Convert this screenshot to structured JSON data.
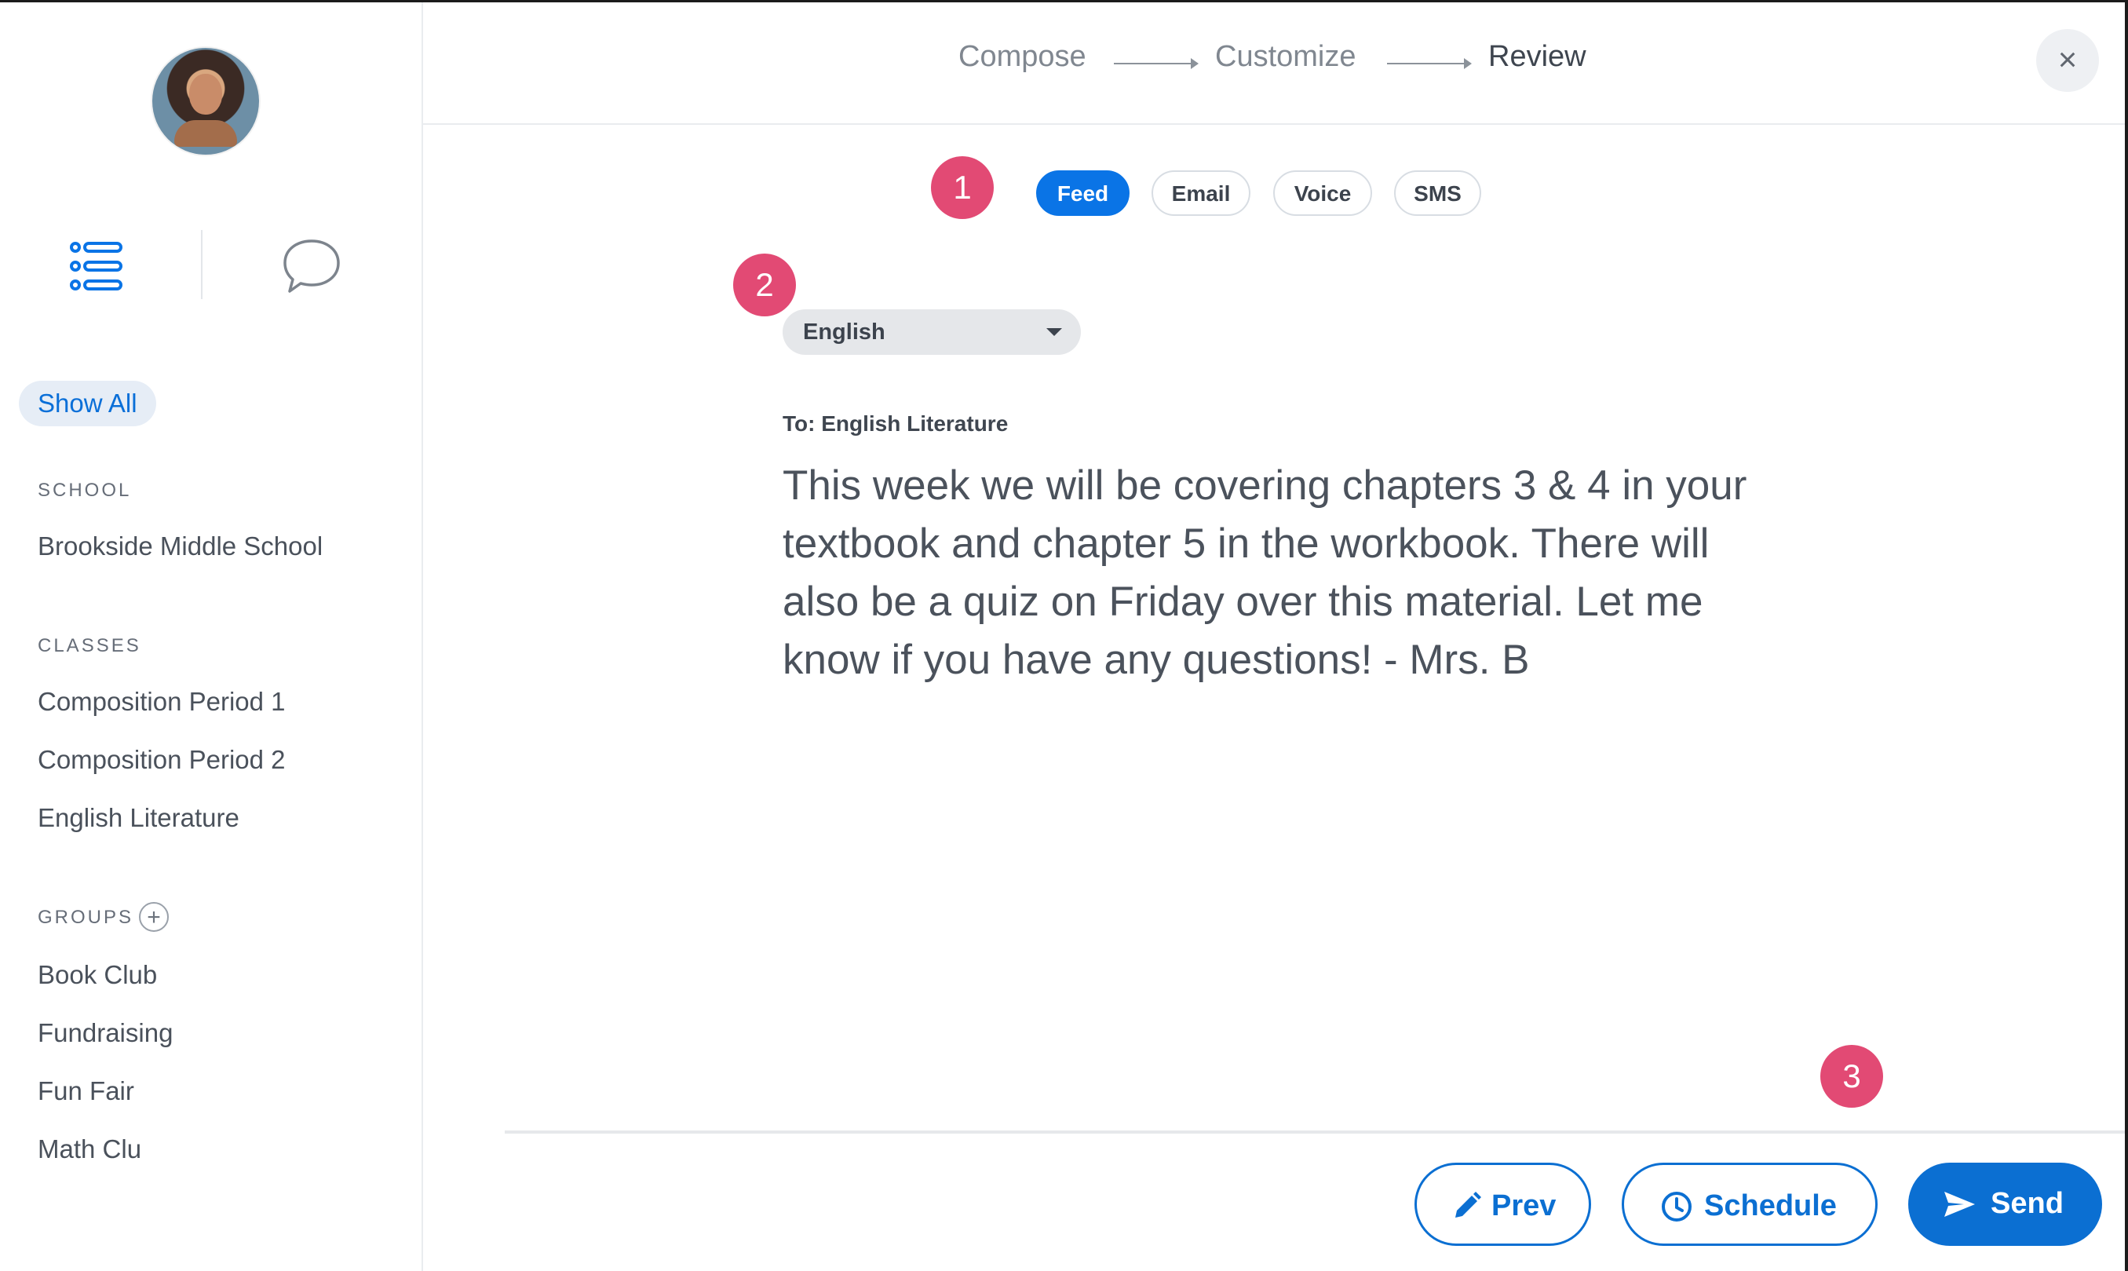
{
  "sidebar": {
    "view_switch": [
      "list-view-icon",
      "chat-view-icon"
    ],
    "show_all_label": "Show All",
    "school": {
      "label": "SCHOOL",
      "items": [
        "Brookside Middle School"
      ]
    },
    "classes": {
      "label": "CLASSES",
      "items": [
        "Composition Period 1",
        "Composition Period 2",
        "English Literature"
      ]
    },
    "groups": {
      "label": "GROUPS",
      "add_icon": "+",
      "items": [
        "Book Club",
        "Fundraising",
        "Fun Fair",
        "Math Clu"
      ]
    }
  },
  "stepper": {
    "steps": [
      {
        "label": "Compose",
        "state": "done"
      },
      {
        "label": "Customize",
        "state": "done"
      },
      {
        "label": "Review",
        "state": "active"
      }
    ],
    "close_icon": "×"
  },
  "main": {
    "channels": [
      {
        "label": "Feed",
        "active": true
      },
      {
        "label": "Email",
        "active": false
      },
      {
        "label": "Voice",
        "active": false
      },
      {
        "label": "SMS",
        "active": false
      }
    ],
    "language": "English",
    "to_label": "To: English Literature",
    "message": "This week we will be covering chapters 3 & 4 in your textbook and chapter 5 in the workbook. There will also be a quiz on Friday over this material. Let me know if you have any questions! - Mrs. B",
    "badges": [
      "1",
      "2",
      "3"
    ]
  },
  "actions": {
    "prev": {
      "label": "Prev",
      "icon": "pencil-icon"
    },
    "schedule": {
      "label": "Schedule",
      "icon": "clock-icon"
    },
    "send": {
      "label": "Send",
      "icon": "send-icon"
    }
  },
  "colors": {
    "accent": "#0b6fd2",
    "badge": "#e24a74",
    "sidebar_highlight": "#e6edf6"
  }
}
